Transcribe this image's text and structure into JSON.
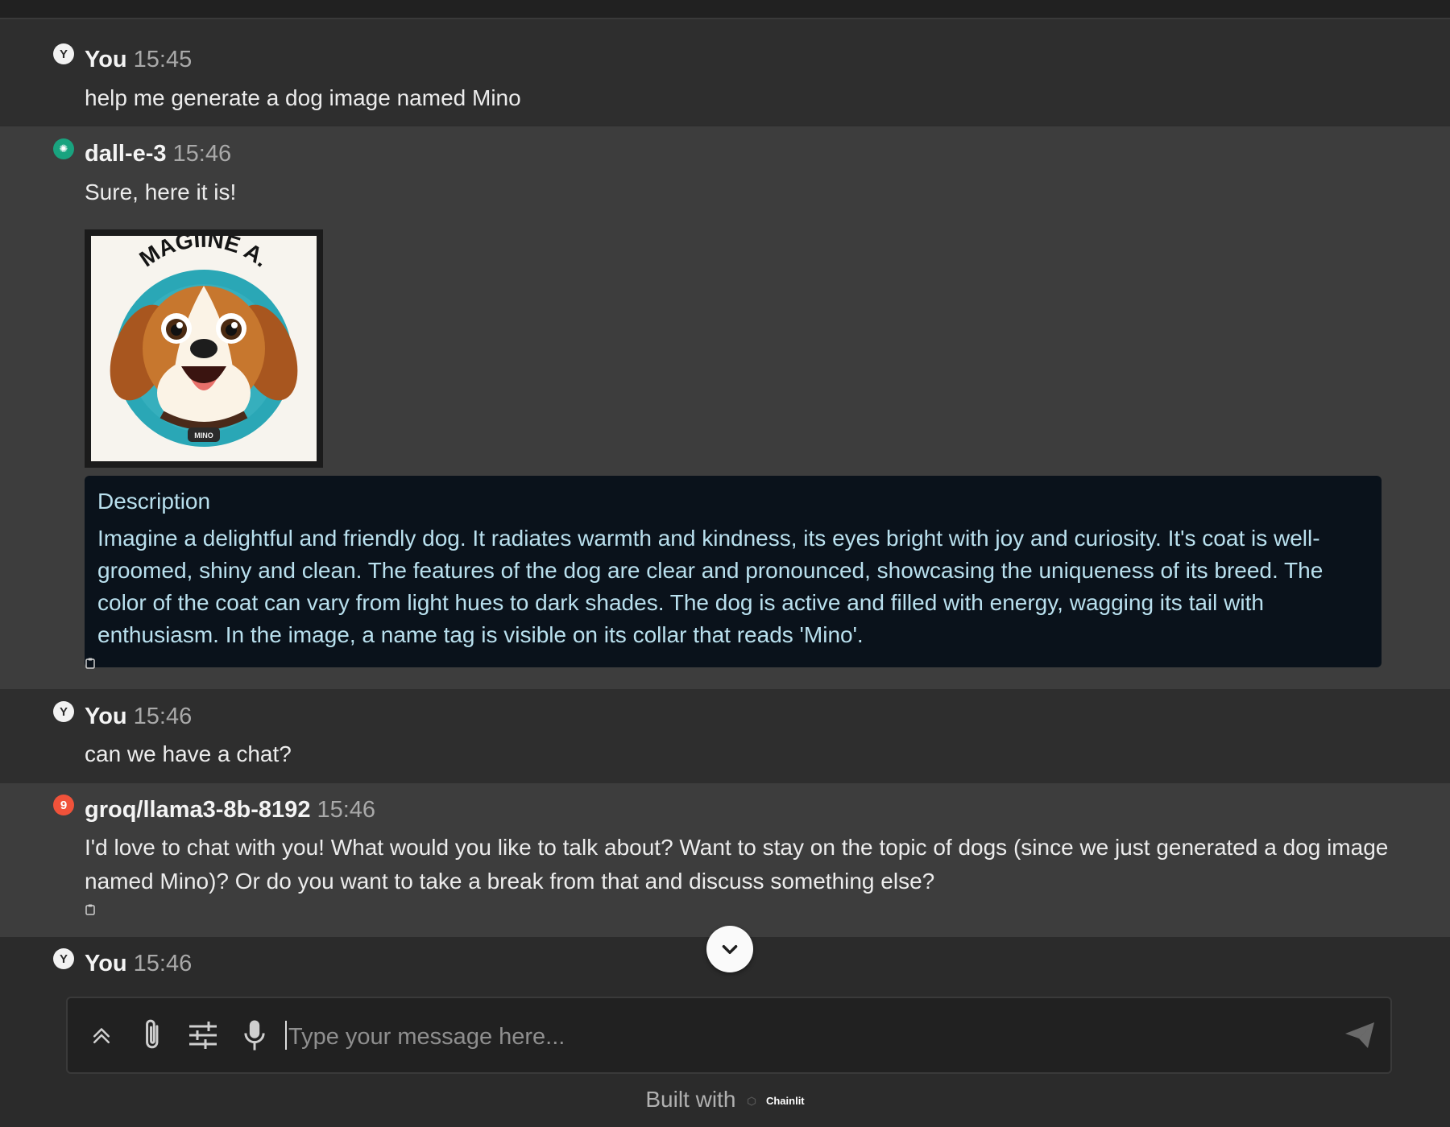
{
  "messages": [
    {
      "author": "You",
      "time": "15:45",
      "text": "help me generate a dog image named Mino"
    },
    {
      "author": "dall-e-3",
      "time": "15:46",
      "text": "Sure, here it is!",
      "image": {
        "arc_text": "MAGIINE A.",
        "tag_text": "MINO"
      },
      "description": {
        "title": "Description",
        "text": "Imagine a delightful and friendly dog. It radiates warmth and kindness, its eyes bright with joy and curiosity. It's coat is well-groomed, shiny and clean. The features of the dog are clear and pronounced, showcasing the uniqueness of its breed. The color of the coat can vary from light hues to dark shades. The dog is active and filled with energy, wagging its tail with enthusiasm. In the image, a name tag is visible on its collar that reads 'Mino'."
      }
    },
    {
      "author": "You",
      "time": "15:46",
      "text": "can we have a chat?"
    },
    {
      "author": "groq/llama3-8b-8192",
      "time": "15:46",
      "text": "I'd love to chat with you! What would you like to talk about? Want to stay on the topic of dogs (since we just generated a dog image named Mino)? Or do you want to take a break from that and discuss something else?"
    },
    {
      "author": "You",
      "time": "15:46"
    }
  ],
  "avatars": {
    "user": "Y",
    "openai": "✺",
    "groq": "9"
  },
  "input": {
    "placeholder": "Type your message here..."
  },
  "footer": {
    "built_with": "Built with",
    "brand": "Chainlit"
  },
  "colors": {
    "background": "#2b2b2b",
    "user_row": "#2e2e2e",
    "bot_row": "#3d3d3d",
    "description_bg": "#0a121b",
    "description_text": "#b9e0ee",
    "openai_green": "#19a37f",
    "groq_red": "#f0523a"
  },
  "icons": [
    "expand-up-icon",
    "paperclip-icon",
    "settings-sliders-icon",
    "microphone-icon",
    "send-icon",
    "chevron-down-icon",
    "copy-icon"
  ]
}
